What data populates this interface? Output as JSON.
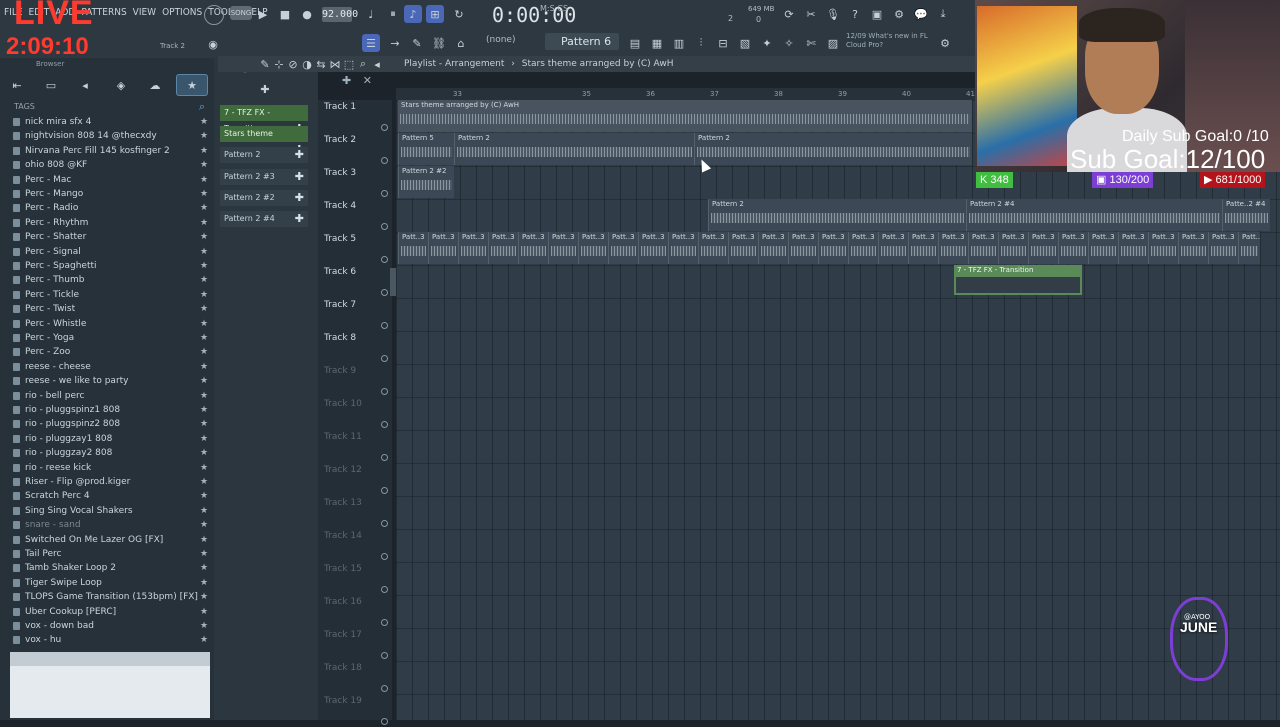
{
  "menu": [
    "FILE",
    "EDIT",
    "ADD",
    "PATTERNS",
    "VIEW",
    "OPTIONS",
    "TOOLS",
    "HELP"
  ],
  "stream": {
    "live": "LIVE",
    "time": "2:09:10"
  },
  "toolbar": {
    "song_mode": "SONG",
    "tempo": "92.000",
    "time": "0:00:00",
    "time_unit": "M:S:CS",
    "mem": "649 MB",
    "mem_bar": "2",
    "mem_zero": "0",
    "pattern": "Pattern 6",
    "snap": "(none)",
    "news_date": "12/09",
    "news_line1": "What's new in FL",
    "news_line2": "Cloud Pro?",
    "hint": "Track 2"
  },
  "browser": {
    "title": "Browser",
    "tags_label": "TAGS",
    "items": [
      "nick mira sfx 4",
      "nightvision 808 14 @thecxdy",
      "Nirvana Perc Fill 145 kosfinger 2",
      "ohio 808 @KF",
      "Perc - Mac",
      "Perc - Mango",
      "Perc - Radio",
      "Perc - Rhythm",
      "Perc - Shatter",
      "Perc - Signal",
      "Perc - Spaghetti",
      "Perc - Thumb",
      "Perc - Tickle",
      "Perc - Twist",
      "Perc - Whistle",
      "Perc - Yoga",
      "Perc - Zoo",
      "reese - cheese",
      "reese - we like to party",
      "rio - bell perc",
      "rio - pluggspinz1 808",
      "rio - pluggspinz2 808",
      "rio - pluggzay1 808",
      "rio - pluggzay2 808",
      "rio - reese kick",
      "Riser - Flip @prod.kiger",
      "Scratch Perc 4",
      "Sing Sing Vocal Shakers",
      "snare - sand",
      "Switched On Me Lazer OG [FX]",
      "Tail Perc",
      "Tamb Shaker Loop 2",
      "Tiger Swipe Loop",
      "TLOPS Game Transition (153bpm) [FX]",
      "Uber Cookup [PERC]",
      "vox - down bad",
      "vox - hu"
    ]
  },
  "channels": [
    "7 - TFZ FX - Transition",
    "Stars theme arrange..",
    "Pattern 2",
    "Pattern 2 #3",
    "Pattern 2 #2",
    "Pattern 2 #4"
  ],
  "playlist": {
    "title": "Playlist - Arrangement",
    "arrangement": "Stars theme arranged by (C) AwH",
    "ruler": [
      "33",
      "35",
      "36",
      "37",
      "38",
      "39",
      "40",
      "41"
    ],
    "tracks": [
      "Track 1",
      "Track 2",
      "Track 3",
      "Track 4",
      "Track 5",
      "Track 6",
      "Track 7",
      "Track 8",
      "Track 9",
      "Track 10",
      "Track 11",
      "Track 12",
      "Track 13",
      "Track 14",
      "Track 15",
      "Track 16",
      "Track 17",
      "Track 18",
      "Track 19"
    ],
    "clips": {
      "t1_audio": "Stars theme arranged by (C) AwH",
      "t2_a": "Pattern 5",
      "t2_b": "Pattern 2",
      "t2_c": "Pattern 2",
      "t3_a": "Pattern 2 #2",
      "t4_a": "Pattern 2",
      "t4_b": "Pattern 2 #4",
      "t4_c": "Patte..2 #4",
      "t5_label": "Patt..3",
      "t6_a": "7 - TFZ FX - Transition"
    }
  },
  "overlay": {
    "daily_goal": "Daily Sub Goal:0  /10",
    "sub_goal": "Sub Goal:12/100",
    "kick_count": "348",
    "twitch_count": "130/200",
    "yt_count": "681/1000",
    "logo_top": "@AYOO",
    "logo_main": "JUNE"
  },
  "colors": {
    "accent_green": "#5a8a58",
    "live_red": "#ff3a2e",
    "twitch_purple": "#7d3fd3"
  }
}
